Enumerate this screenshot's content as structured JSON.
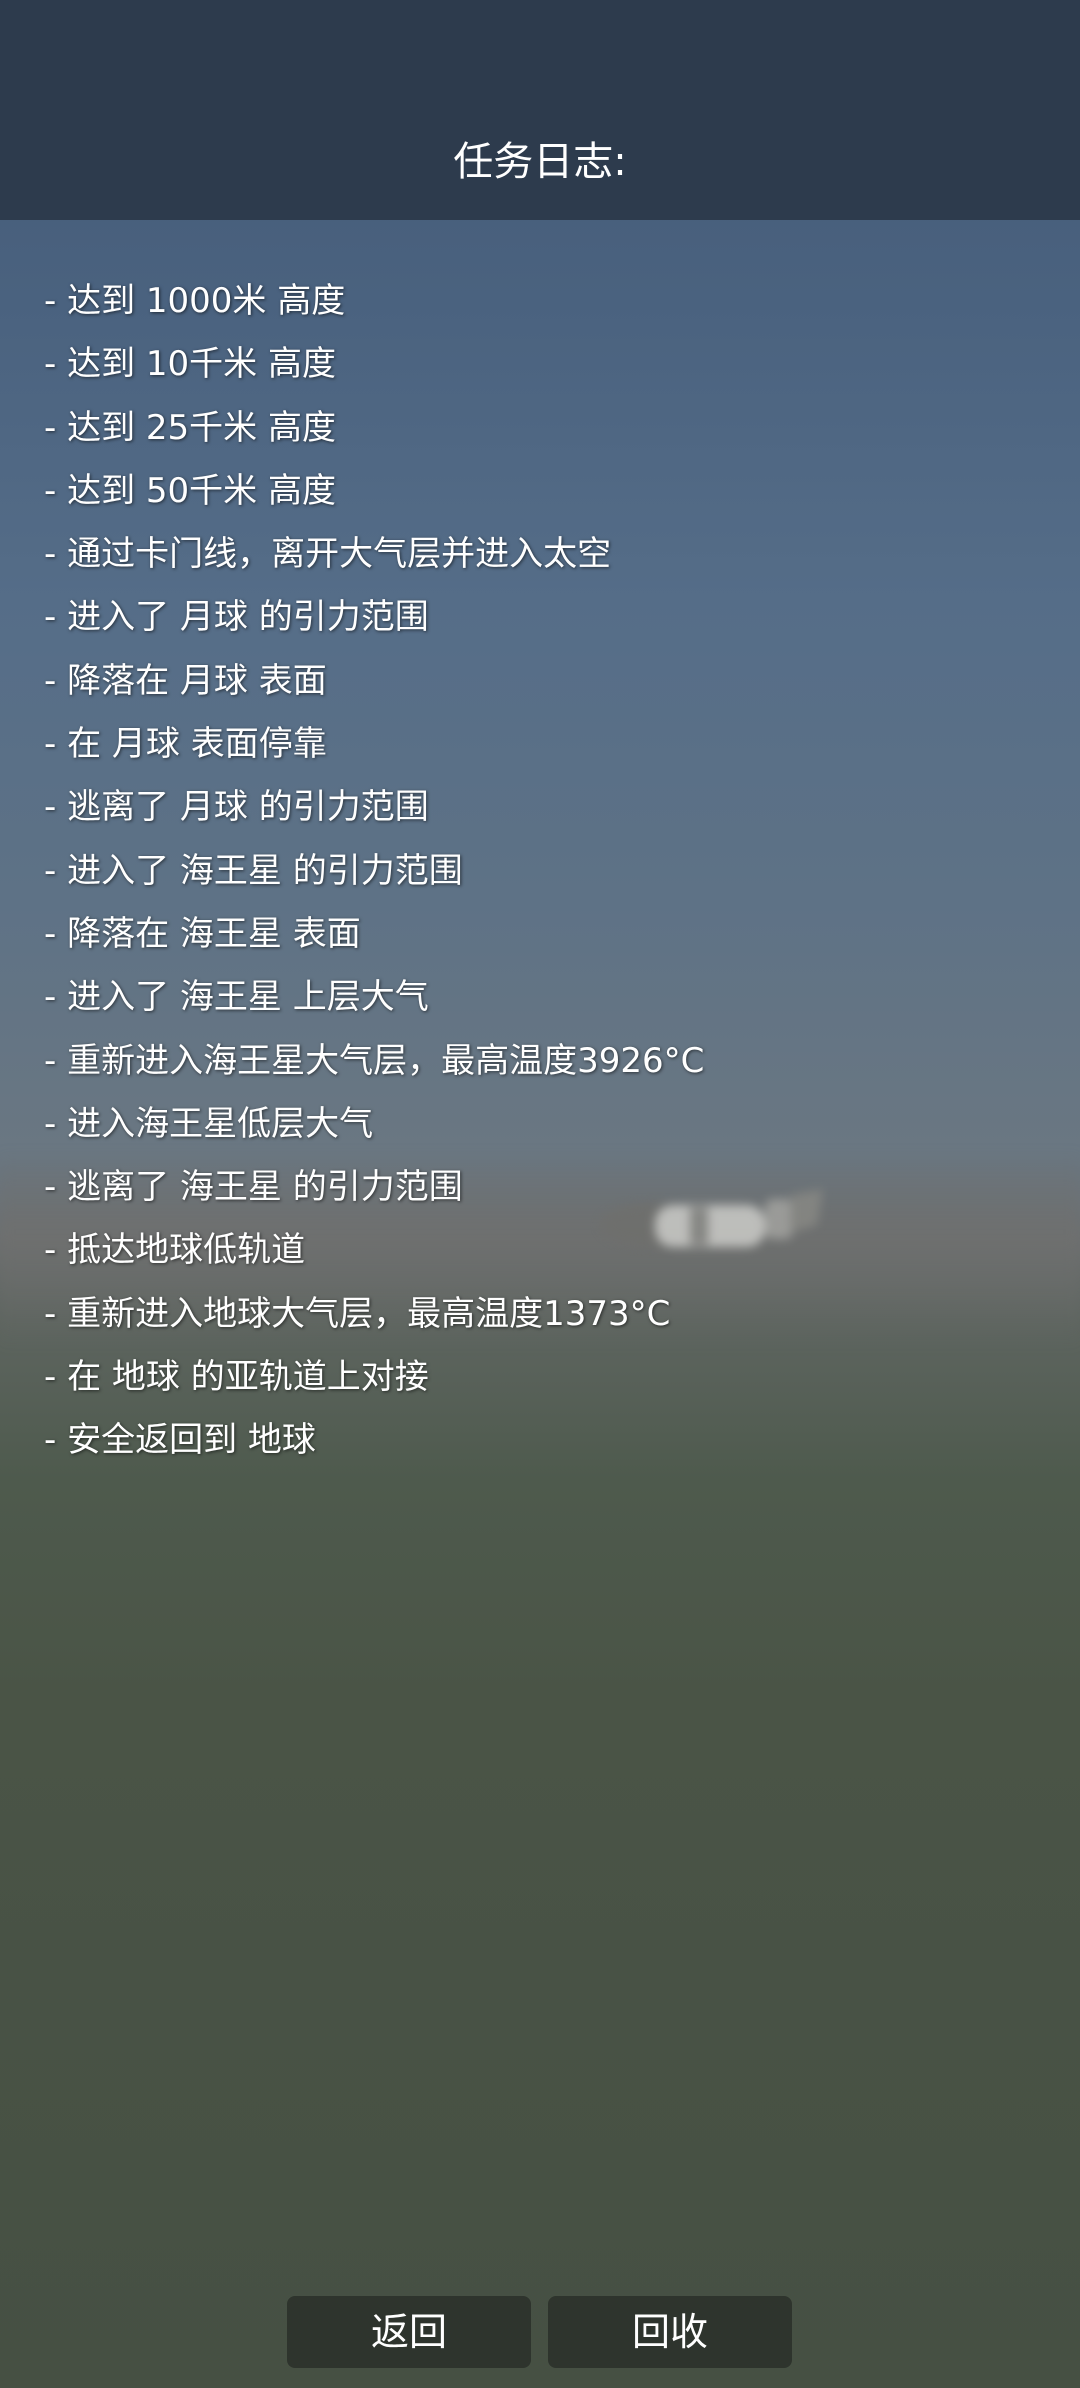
{
  "header": {
    "title": "任务日志:"
  },
  "log": {
    "entries": [
      "- 达到 1000米 高度",
      "- 达到 10千米 高度",
      "- 达到 25千米 高度",
      "- 达到 50千米 高度",
      "- 通过卡门线，离开大气层并进入太空",
      "- 进入了 月球 的引力范围",
      "- 降落在 月球 表面",
      "- 在 月球 表面停靠",
      "- 逃离了 月球 的引力范围",
      "- 进入了 海王星 的引力范围",
      "- 降落在 海王星 表面",
      "- 进入了 海王星 上层大气",
      "- 重新进入海王星大气层，最高温度3926°C",
      "- 进入海王星低层大气",
      "- 逃离了 海王星 的引力范围",
      "- 抵达地球低轨道",
      "- 重新进入地球大气层，最高温度1373°C",
      "- 在 地球 的亚轨道上对接",
      "- 安全返回到 地球"
    ]
  },
  "buttons": {
    "back_label": "返回",
    "recover_label": "回收"
  },
  "colors": {
    "header_bg": "#2d3b4d",
    "button_bg": "#2e342d",
    "text": "#ffffff"
  },
  "icons": {
    "background_rocket": "rocket-silhouette"
  }
}
